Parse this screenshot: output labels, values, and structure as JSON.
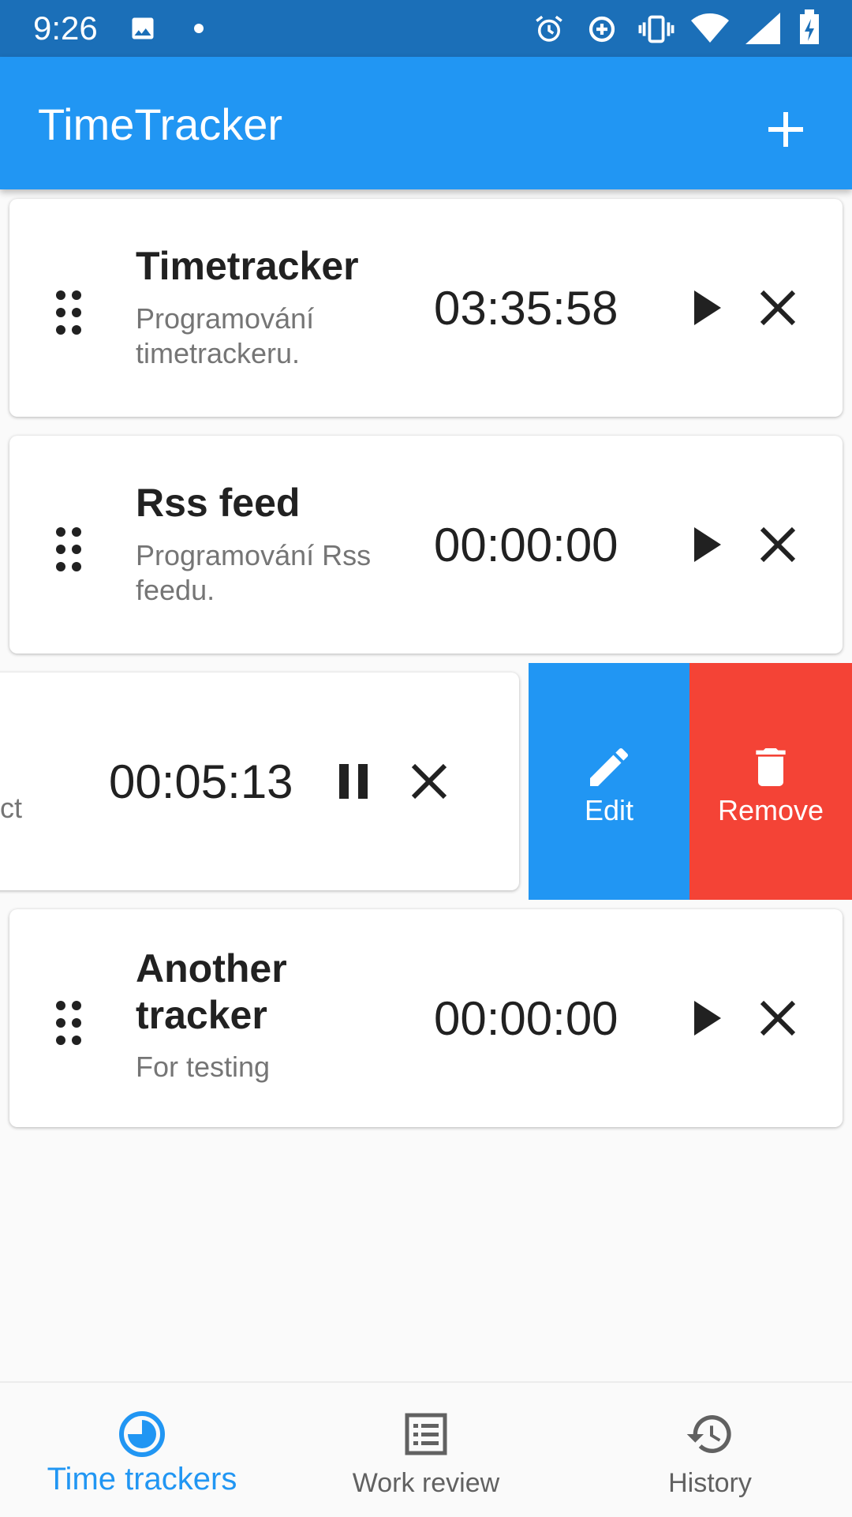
{
  "status_bar": {
    "time": "9:26",
    "icons": [
      "image-icon",
      "notification-dot-icon",
      "alarm-icon",
      "data-saver-icon",
      "vibrate-icon",
      "wifi-icon",
      "signal-icon",
      "battery-charging-icon"
    ]
  },
  "app_bar": {
    "title": "TimeTracker",
    "action_icon": "add-icon"
  },
  "trackers": [
    {
      "name": "Timetracker",
      "description": "Programování timetrackeru.",
      "time": "03:35:58",
      "state": "stopped"
    },
    {
      "name": "Rss feed",
      "description": "Programování Rss feedu.",
      "time": "00:00:00",
      "state": "stopped"
    },
    {
      "partial_text": "ct",
      "time": "00:05:13",
      "state": "running"
    },
    {
      "name": "Another tracker",
      "description": "For testing",
      "time": "00:00:00",
      "state": "stopped"
    }
  ],
  "swipe_actions": {
    "edit": {
      "label": "Edit",
      "color": "#2196f3",
      "icon": "pencil-icon"
    },
    "remove": {
      "label": "Remove",
      "color": "#f44336",
      "icon": "trash-icon"
    }
  },
  "bottom_nav": {
    "items": [
      {
        "label": "Time trackers",
        "icon": "timer-icon",
        "active": true
      },
      {
        "label": "Work review",
        "icon": "list-icon",
        "active": false
      },
      {
        "label": "History",
        "icon": "history-icon",
        "active": false
      }
    ]
  },
  "colors": {
    "primary": "#2196f3",
    "status_bar": "#1b6fb8",
    "danger": "#f44336",
    "text_secondary": "#757575"
  }
}
